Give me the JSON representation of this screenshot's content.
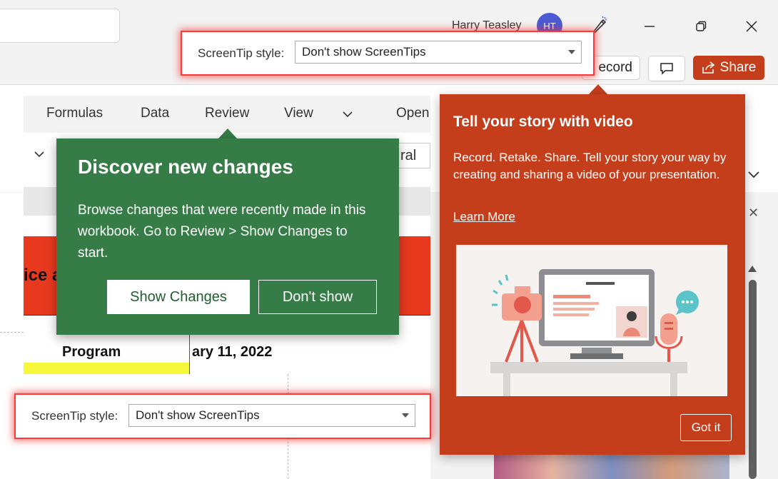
{
  "title_bar": {
    "user_name": "Harry Teasley",
    "avatar_initials": "HT"
  },
  "toolbar": {
    "record_label": "ecord",
    "share_label": "Share"
  },
  "excel": {
    "tabs": [
      {
        "label": "Formulas"
      },
      {
        "label": "Data"
      },
      {
        "label": "Review"
      },
      {
        "label": "View"
      }
    ],
    "open_partial": "Open",
    "number_format_partial": "ral",
    "red_cell_partial": "ice a",
    "cells": {
      "program": "Program",
      "date_partial": "ary 11, 2022"
    }
  },
  "screentip_top": {
    "label": "ScreenTip style:",
    "value": "Don't show ScreenTips"
  },
  "screentip_bottom": {
    "label": "ScreenTip style:",
    "value": "Don't show ScreenTips"
  },
  "green_callout": {
    "title": "Discover new changes",
    "body": "Browse changes that were recently made in this workbook. Go to Review > Show Changes to start.",
    "primary_button": "Show Changes",
    "secondary_button": "Don't show",
    "color": "#367c46"
  },
  "orange_callout": {
    "title": "Tell your story with video",
    "body": "Record. Retake. Share. Tell your story your way by creating and sharing a video of your presentation.",
    "link": "Learn More",
    "button": "Got it",
    "color": "#c43e1c"
  },
  "icons": {
    "window_controls": [
      "minimize-icon",
      "restore-icon",
      "close-icon"
    ],
    "pen": "pen-icon",
    "comment": "comment-icon",
    "share": "share-icon"
  }
}
